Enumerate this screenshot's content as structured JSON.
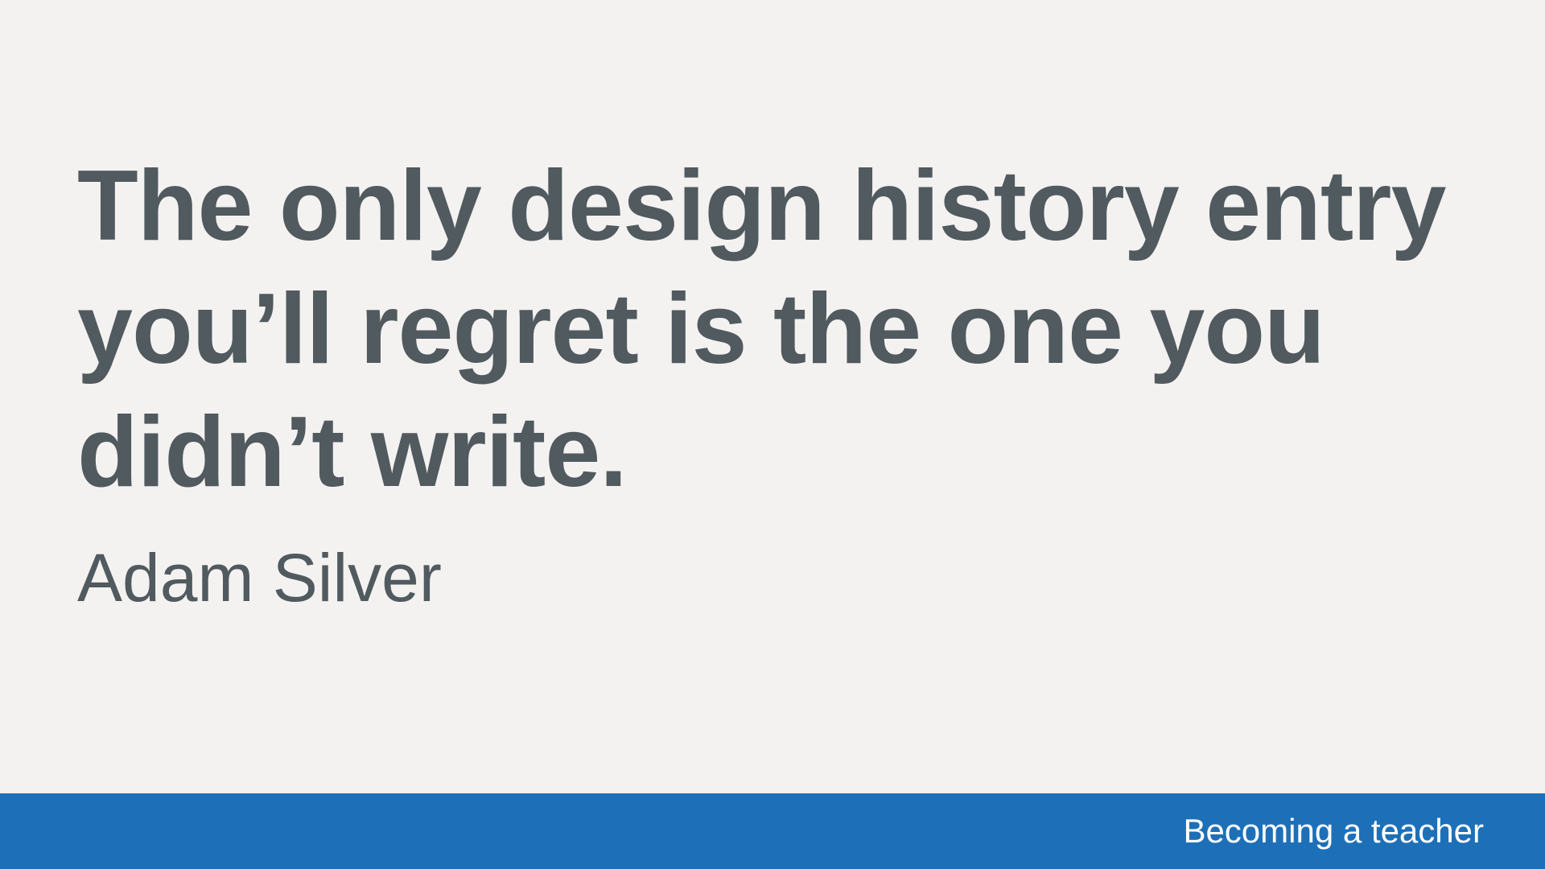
{
  "slide": {
    "quote": "The only design history entry you’ll regret is the one you didn’t write.",
    "author": "Adam Silver",
    "footer": {
      "label": "Becoming a teacher"
    }
  },
  "colors": {
    "background": "#f4f2f1",
    "text": "#505a5f",
    "footer_bar": "#1d70b8",
    "footer_text": "#ffffff"
  }
}
